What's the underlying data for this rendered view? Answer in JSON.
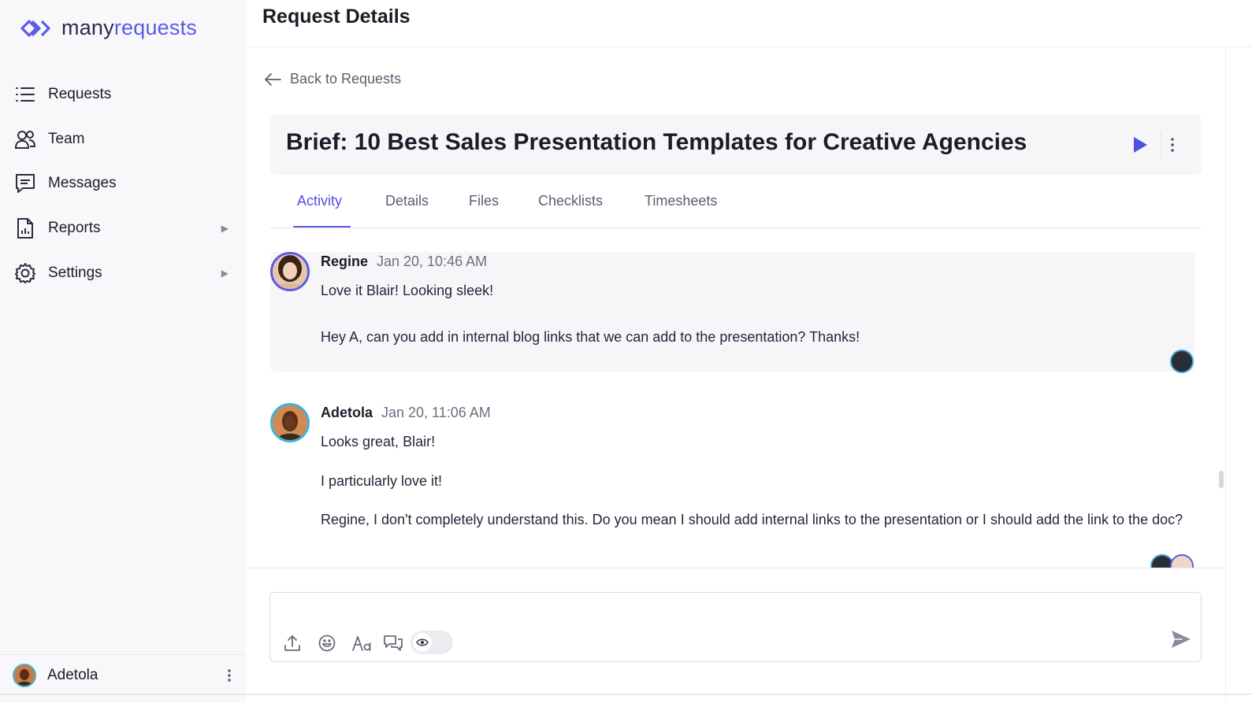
{
  "brand": {
    "name_part1": "many",
    "name_part2": "requests",
    "accent": "#5b5be6"
  },
  "sidebar": {
    "items": [
      {
        "label": "Requests",
        "icon": "list-icon"
      },
      {
        "label": "Team",
        "icon": "team-icon"
      },
      {
        "label": "Messages",
        "icon": "message-icon"
      },
      {
        "label": "Reports",
        "icon": "report-icon",
        "has_submenu": true
      },
      {
        "label": "Settings",
        "icon": "gear-icon",
        "has_submenu": true
      }
    ],
    "user": {
      "name": "Adetola"
    }
  },
  "header": {
    "title": "Request Details"
  },
  "back_link": {
    "label": "Back to Requests"
  },
  "request": {
    "title": "Brief: 10 Best Sales Presentation Templates for Creative Agencies"
  },
  "tabs": [
    {
      "label": "Activity",
      "active": true
    },
    {
      "label": "Details"
    },
    {
      "label": "Files"
    },
    {
      "label": "Checklists"
    },
    {
      "label": "Timesheets"
    }
  ],
  "comments": [
    {
      "author": "Regine",
      "time": "Jan 20, 10:46 AM",
      "paragraphs": [
        "Love it Blair! Looking sleek!",
        "Hey A, can you add in internal blog links that we can add to the presentation? Thanks!"
      ]
    },
    {
      "author": "Adetola",
      "time": "Jan 20, 11:06 AM",
      "paragraphs": [
        "Looks great, Blair!",
        "I particularly love it!",
        "Regine, I don't completely understand this. Do you mean I should add internal links to the presentation or I should add the link to the doc?"
      ]
    }
  ],
  "composer": {
    "placeholder": "",
    "tools": [
      "upload-icon",
      "emoji-icon",
      "text-format-icon",
      "quote-icon"
    ],
    "visibility_toggle": "eye-icon"
  }
}
